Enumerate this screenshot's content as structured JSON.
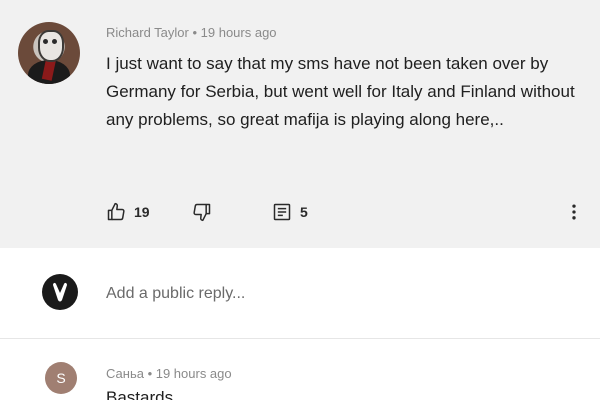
{
  "comment": {
    "author": "Richard Taylor",
    "time": "19 hours ago",
    "separator": " • ",
    "text": "I just want to say that my sms have not been taken over by Germany for Serbia, but went well for Italy and Finland without any problems, so great mafija is playing along here,..",
    "likes": "19",
    "replies": "5",
    "icons": {
      "like": "thumbs-up-icon",
      "dislike": "thumbs-down-icon",
      "replies": "comment-replies-icon",
      "more": "more-vertical-icon"
    }
  },
  "reply_box": {
    "placeholder": "Add a public reply..."
  },
  "next_comment": {
    "avatar_letter": "S",
    "author": "Саньа",
    "time": "19 hours ago",
    "text": "Bastards"
  },
  "colors": {
    "comment_background": "#f1f1f1",
    "meta_text": "#8a8a8a",
    "avatar_s": "#a07f72"
  }
}
